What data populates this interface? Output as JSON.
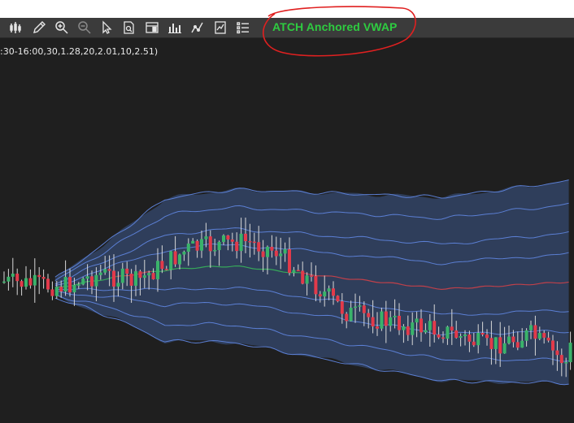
{
  "toolbar": {
    "buttons": [
      {
        "icon": "bar-chart-icon"
      },
      {
        "icon": "pencil-icon"
      },
      {
        "icon": "zoom-in-icon"
      },
      {
        "icon": "zoom-out-icon"
      },
      {
        "icon": "cursor-arrow-icon"
      },
      {
        "icon": "document-search-icon"
      },
      {
        "icon": "data-box-icon"
      },
      {
        "icon": "volume-bars-icon"
      },
      {
        "icon": "line-chart-icon"
      },
      {
        "icon": "strategy-icon"
      },
      {
        "icon": "list-icon"
      }
    ],
    "indicator_name": "ATCH Anchored VWAP"
  },
  "indicator": {
    "params": ":30-16:00,30,1.28,20,2.01,10,2.51)"
  },
  "colors": {
    "background": "#1f1f1f",
    "toolbar": "#3b3b3b",
    "indicator_text": "#2ecc40",
    "band_fill": "#324466",
    "band_line": "#5b7fd4",
    "vwap_green": "#36a85a",
    "vwap_red": "#c0404a",
    "candle_up": "#3ab36a",
    "candle_down": "#e23a4a",
    "annotation": "#e02020"
  },
  "chart_data": {
    "type": "candlestick",
    "seed": 7,
    "bars": 130,
    "title": "",
    "xlabel": "",
    "ylabel": ""
  }
}
